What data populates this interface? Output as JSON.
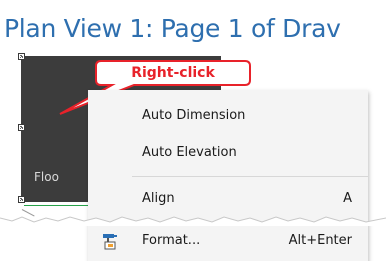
{
  "view": {
    "title": "Plan View 1: Page 1 of Drav",
    "plan_label": "Floo"
  },
  "callout": {
    "text": "Right-click",
    "border_color": "#e8222a"
  },
  "context_menu": {
    "items": [
      {
        "label": "Auto Dimension",
        "shortcut": "",
        "icon": ""
      },
      {
        "label": "Auto Elevation",
        "shortcut": "",
        "icon": ""
      },
      {
        "label": "Align",
        "shortcut": "A",
        "icon": ""
      },
      {
        "label": "Format...",
        "shortcut": "Alt+Enter",
        "icon": "format-paint-icon"
      }
    ]
  },
  "colors": {
    "title": "#2e6faf",
    "plan_fill": "#3c3c3c",
    "menu_bg": "#f4f4f4",
    "dimension_line": "#27a34a"
  }
}
